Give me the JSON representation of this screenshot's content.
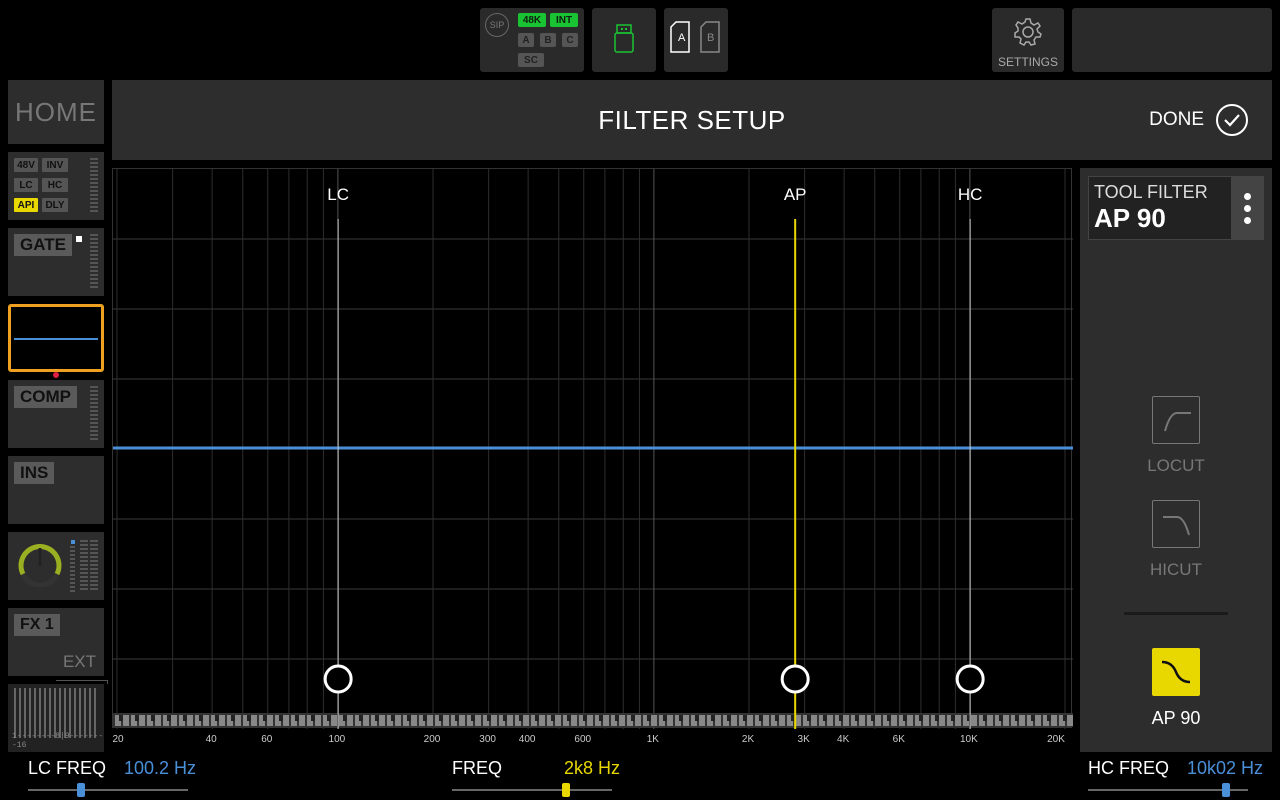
{
  "topbar": {
    "sip": "SIP",
    "chips_green": [
      "48K",
      "INT"
    ],
    "chips_gray": [
      "A",
      "B",
      "C",
      "SC"
    ],
    "scene_a": "A",
    "scene_b": "B",
    "settings_label": "SETTINGS"
  },
  "strip": {
    "home": "HOME",
    "preamp_buttons": [
      "48V",
      "INV",
      "LC",
      "HC",
      "API",
      "DLY"
    ],
    "gate": "GATE",
    "comp": "COMP",
    "ins": "INS",
    "fx": "FX 1",
    "ext": "EXT",
    "meter_scale": "1--------8|9--------16"
  },
  "header": {
    "title": "FILTER SETUP",
    "done": "DONE"
  },
  "graph": {
    "markers": [
      {
        "label": "LC",
        "freq_hz": 100.2,
        "color": "#cccccc"
      },
      {
        "label": "AP",
        "freq_hz": 2800,
        "color": "#e8d800"
      },
      {
        "label": "HC",
        "freq_hz": 10020,
        "color": "#cccccc"
      }
    ],
    "freq_range_hz": [
      20,
      20000
    ],
    "freq_tick_labels": [
      "20",
      "40",
      "60",
      "100",
      "200",
      "300",
      "400",
      "600",
      "1K",
      "2K",
      "3K",
      "4K",
      "6K",
      "10K",
      "20K"
    ],
    "response_color": "#4a90d9"
  },
  "tool_panel": {
    "label": "TOOL FILTER",
    "value": "AP 90",
    "locut": "LOCUT",
    "hicut": "HICUT",
    "ap_label": "AP 90"
  },
  "params": {
    "lc": {
      "name": "LC FREQ",
      "value": "100.2 Hz",
      "color": "#4a90d9",
      "position": 0.33
    },
    "freq": {
      "name": "FREQ",
      "value": "2k8 Hz",
      "color": "#e8d800",
      "position": 0.71
    },
    "hc": {
      "name": "HC FREQ",
      "value": "10k02 Hz",
      "color": "#4a90d9",
      "position": 0.86
    }
  }
}
